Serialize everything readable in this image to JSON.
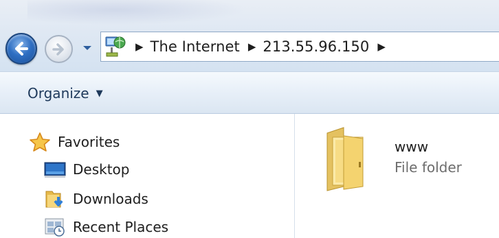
{
  "address_bar": {
    "location_icon": "network-globe-icon",
    "crumbs": [
      "The Internet",
      "213.55.96.150"
    ]
  },
  "navigation": {
    "back_icon": "back-arrow-icon",
    "forward_icon": "forward-arrow-icon",
    "history_icon": "chevron-down-icon"
  },
  "toolbar": {
    "organize_label": "Organize",
    "organize_icon": "caret-down-icon"
  },
  "nav_pane": {
    "favorites": {
      "label": "Favorites",
      "icon": "star-icon"
    },
    "items": [
      {
        "label": "Desktop",
        "icon": "desktop-icon"
      },
      {
        "label": "Downloads",
        "icon": "downloads-folder-icon"
      },
      {
        "label": "Recent Places",
        "icon": "recent-places-icon"
      }
    ]
  },
  "content": {
    "items": [
      {
        "name": "www",
        "type": "File folder",
        "icon": "folder-icon"
      }
    ]
  },
  "colors": {
    "accent_blue": "#2f6fc3",
    "command_bar": "#e7eff8",
    "folder_yellow": "#f2d36b"
  }
}
